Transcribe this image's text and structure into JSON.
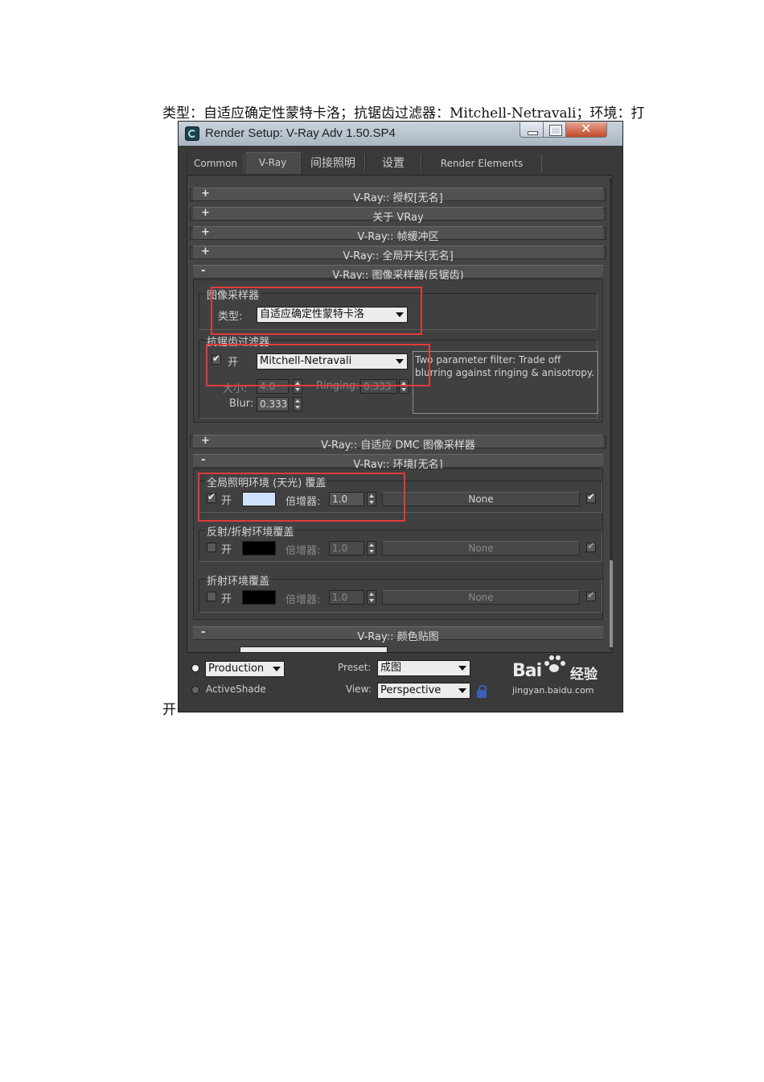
{
  "document": {
    "line1": "类型：自适应确定性蒙特卡洛；抗锯齿过滤器：Mitchell-Netravali；环境：打",
    "line2": "开"
  },
  "window": {
    "title": "Render Setup: V-Ray Adv 1.50.SP4",
    "close_label": "✕"
  },
  "tabs": [
    {
      "label": "Common"
    },
    {
      "label": "V-Ray",
      "active": true
    },
    {
      "label": "间接照明"
    },
    {
      "label": "设置"
    },
    {
      "label": "Render Elements"
    }
  ],
  "rollouts": {
    "auth": {
      "sign": "+",
      "title": "V-Ray:: 授权[无名]"
    },
    "about": {
      "sign": "+",
      "title": "关于 VRay"
    },
    "framebuffer": {
      "sign": "+",
      "title": "V-Ray:: 帧缓冲区"
    },
    "global": {
      "sign": "+",
      "title": "V-Ray:: 全局开关[无名]"
    },
    "image_sampler": {
      "sign": "-",
      "title": "V-Ray:: 图像采样器(反锯齿)"
    },
    "dmc": {
      "sign": "+",
      "title": "V-Ray:: 自适应 DMC 图像采样器"
    },
    "environment": {
      "sign": "-",
      "title": "V-Ray:: 环境[无名]"
    },
    "color_mapping": {
      "sign": "-",
      "title": "V-Ray:: 颜色贴图"
    }
  },
  "image_sampler": {
    "group_label": "图像采样器",
    "type_label": "类型:",
    "type_value": "自适应确定性蒙特卡洛"
  },
  "aa_filter": {
    "group_label": "抗锯齿过滤器",
    "on_label": "开",
    "on_checked": true,
    "filter_value": "Mitchell-Netravali",
    "description": "Two parameter filter: Trade off blurring against ringing & anisotropy.",
    "size_label": "大小:",
    "size_value": "4.0",
    "ringing_label": "Ringing:",
    "ringing_value": "0.333",
    "blur_label": "Blur:",
    "blur_value": "0.333"
  },
  "environment": {
    "gi": {
      "group_label": "全局照明环境 (天光) 覆盖",
      "on_label": "开",
      "on_checked": true,
      "swatch_color": "#cfe2fb",
      "multiplier_label": "倍增器:",
      "multiplier_value": "1.0",
      "map_label": "None",
      "map_checked": true
    },
    "reflection": {
      "group_label": "反射/折射环境覆盖",
      "on_label": "开",
      "on_checked": false,
      "swatch_color": "#000000",
      "multiplier_label": "倍增器:",
      "multiplier_value": "1.0",
      "map_label": "None",
      "map_checked": true
    },
    "refraction": {
      "group_label": "折射环境覆盖",
      "on_label": "开",
      "on_checked": false,
      "swatch_color": "#000000",
      "multiplier_label": "倍增器:",
      "multiplier_value": "1.0",
      "map_label": "None",
      "map_checked": true
    }
  },
  "bottom": {
    "production_value": "Production",
    "activeshade_label": "ActiveShade",
    "preset_label": "Preset:",
    "preset_value": "成图",
    "view_label": "View:",
    "view_value": "Perspective"
  },
  "watermark": {
    "logo": "Bai",
    "logo_cn": "经验",
    "url": "jingyan.baidu.com"
  },
  "colors": {
    "highlight": "#e23a3a",
    "panel_bg": "#404040"
  }
}
